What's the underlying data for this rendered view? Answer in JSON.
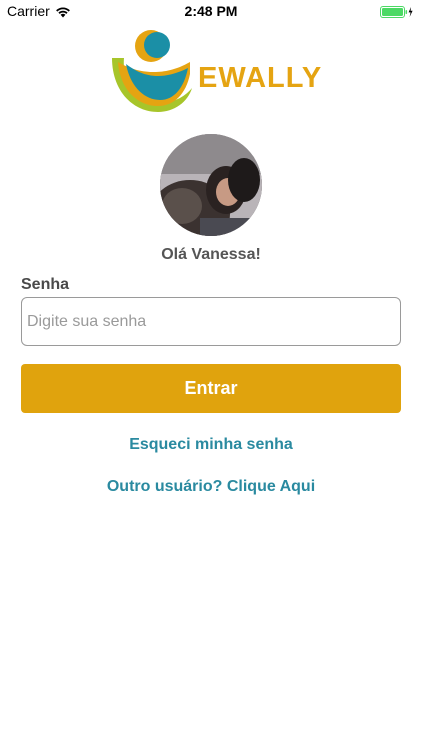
{
  "status_bar": {
    "carrier": "Carrier",
    "time": "2:48 PM",
    "wifi_icon": "wifi-icon",
    "battery_icon": "battery-charging-icon",
    "battery_color": "#4cd964"
  },
  "brand": {
    "name": "EWALLY",
    "logo_icon": "person-logo-icon",
    "primary_color": "#e0a30d",
    "secondary_color": "#1b8fa6",
    "accent_color": "#a7c52a"
  },
  "profile": {
    "greeting": "Olá Vanessa!"
  },
  "login_form": {
    "password_label": "Senha",
    "password_placeholder": "Digite sua senha",
    "password_value": "",
    "submit_label": "Entrar"
  },
  "links": {
    "forgot_password": "Esqueci minha senha",
    "other_user": "Outro usuário? Clique Aqui",
    "link_color": "#2a8aa0"
  }
}
